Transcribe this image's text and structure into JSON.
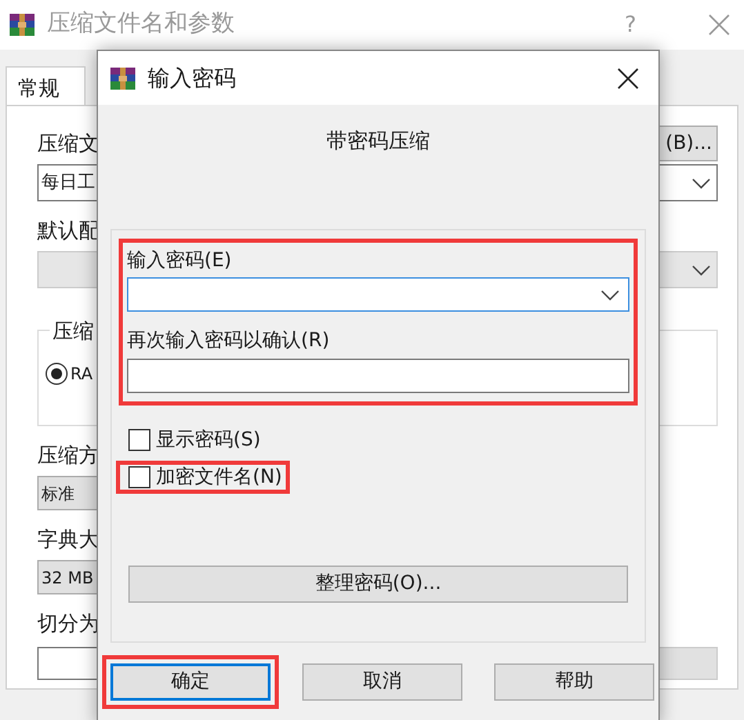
{
  "main_window": {
    "title": "压缩文件名和参数",
    "help_glyph": "?",
    "tabs": [
      {
        "label": "常规",
        "selected": true
      }
    ],
    "rows": [
      {
        "kind": "label",
        "text": "压缩文",
        "right_button": "(B)..."
      },
      {
        "kind": "combo",
        "value": "每日工",
        "disabled": false
      },
      {
        "kind": "label",
        "text": "默认配"
      },
      {
        "kind": "combo",
        "disabled": true
      },
      {
        "kind": "group",
        "title": "压缩",
        "radio": {
          "label": "RA",
          "selected": true
        }
      },
      {
        "kind": "label",
        "text": "压缩方"
      },
      {
        "kind": "select",
        "value": "标准"
      },
      {
        "kind": "label",
        "text": "字典大"
      },
      {
        "kind": "select",
        "value": "32 MB"
      },
      {
        "kind": "label",
        "text": "切分为"
      },
      {
        "kind": "input"
      }
    ]
  },
  "dialog": {
    "title": "输入密码",
    "heading": "带密码压缩",
    "fields_highlighted": true,
    "password": {
      "label": "输入密码(E)",
      "focused": true
    },
    "confirm": {
      "label": "再次输入密码以确认(R)"
    },
    "checkboxes": [
      {
        "label": "显示密码(S)",
        "checked": false,
        "highlighted": false
      },
      {
        "label": "加密文件名(N)",
        "checked": false,
        "highlighted": true
      }
    ],
    "organize_button": "整理密码(O)...",
    "buttons": [
      {
        "label": "确定",
        "default": true,
        "highlighted": true
      },
      {
        "label": "取消",
        "default": false,
        "highlighted": false
      },
      {
        "label": "帮助",
        "default": false,
        "highlighted": false
      }
    ]
  }
}
